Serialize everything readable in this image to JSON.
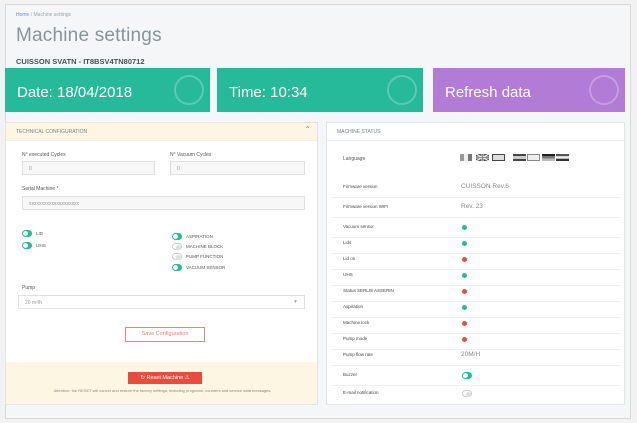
{
  "breadcrumb": {
    "home": "Home",
    "current": "Machine settings"
  },
  "page_title": "Machine settings",
  "machine_id": "CUISSON SVATN - IT8BSV4TN80712",
  "cards": {
    "date": "Date: 18/04/2018",
    "time": "Time: 10:34",
    "refresh": "Refresh data"
  },
  "config": {
    "header": "Technical configuration",
    "collapse": "⌃",
    "executed_cycles_label": "N° executed Cycles",
    "executed_cycles_value": "0",
    "vacuum_cycles_label": "N° Vacuum Cycles",
    "vacuum_cycles_value": "0",
    "serial_label": "Serial Machine *",
    "serial_value": "xxxxxxxxxxxxxxxxxxxx",
    "toggles_left": [
      {
        "label": "Lid"
      },
      {
        "label": "IJHS"
      }
    ],
    "toggles_right": [
      {
        "label": "Aspiration"
      },
      {
        "label": "Machine block"
      },
      {
        "label": "Pump function"
      },
      {
        "label": "Vacuum sensor"
      }
    ],
    "pump_label": "Pump",
    "pump_value": "20 m³/h",
    "save_button": "Save Configuration",
    "reset_button": "↻ Reset Machine ⚠",
    "reset_note": "Attention: the RESET will cancel and restore the factory settings, including programs, counters and service data messages."
  },
  "status": {
    "header": "Machine status",
    "language_label": "Language",
    "rows": [
      {
        "label": "Firmware version",
        "value": "CUISSON Rev.6"
      },
      {
        "label": "Firmware version WIFI",
        "value": "Rev. 23"
      },
      {
        "label": "Vacuum sensor",
        "state": "ok"
      },
      {
        "label": "Lids",
        "state": "ok"
      },
      {
        "label": "Lid on",
        "state": "err"
      },
      {
        "label": "IJHS",
        "state": "ok"
      },
      {
        "label": "Status SERLIS ASSERIN",
        "state": "err"
      },
      {
        "label": "Aspiration",
        "state": "ok"
      },
      {
        "label": "Machine lock",
        "state": "err"
      },
      {
        "label": "Pump mode",
        "state": "err"
      },
      {
        "label": "Pump flow rate",
        "value": "20M/H"
      },
      {
        "label": "Buzzer",
        "toggle": "on"
      },
      {
        "label": "E-mail notification",
        "toggle": "off"
      }
    ]
  },
  "colors": {
    "teal": "#26b99a",
    "purple": "#b27bd6",
    "red": "#e74c3c"
  }
}
